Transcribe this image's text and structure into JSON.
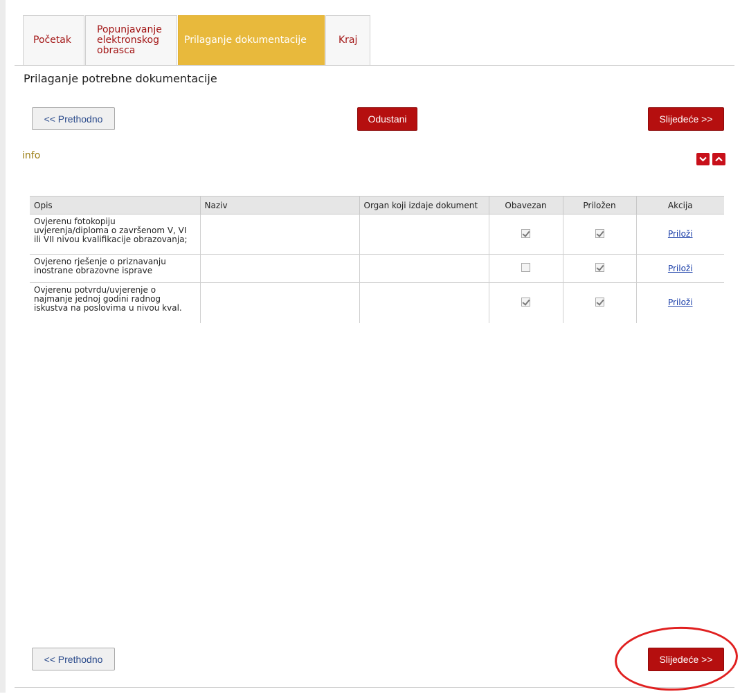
{
  "tabs": [
    {
      "label": "Početak",
      "active": false
    },
    {
      "label_lines": [
        "Popunjavanje",
        "elektronskog",
        "obrasca"
      ],
      "active": false
    },
    {
      "label": "Prilaganje dokumentacije",
      "active": true
    },
    {
      "label": "Kraj",
      "active": false
    }
  ],
  "heading": "Prilaganje potrebne dokumentacije",
  "buttons": {
    "previous": "<< Prethodno",
    "cancel": "Odustani",
    "next": "Slijedeće >>"
  },
  "info_label": "info",
  "table": {
    "headers": [
      "Opis",
      "Naziv",
      "Organ koji izdaje dokument",
      "Obavezan",
      "Priložen",
      "Akcija"
    ],
    "rows": [
      {
        "opis_lines": [
          "Ovjerenu fotokopiju",
          "uvjerenja/diploma o završenom V, VI",
          "ili VII nivou kvalifikacije obrazovanja;"
        ],
        "naziv": "",
        "organ": "",
        "obavezan": true,
        "prilozen": true,
        "akcija": "Priloži"
      },
      {
        "opis_lines": [
          "Ovjereno rješenje o priznavanju",
          "inostrane obrazovne isprave"
        ],
        "naziv": "",
        "organ": "",
        "obavezan": false,
        "prilozen": true,
        "akcija": "Priloži"
      },
      {
        "opis_lines": [
          "Ovjerenu potvrdu/uvjerenje o",
          "najmanje jednoj godini radnog",
          "iskustva na poslovima u nivou kval."
        ],
        "naziv": "",
        "organ": "",
        "obavezan": true,
        "prilozen": true,
        "akcija": "Priloži"
      }
    ]
  },
  "colors": {
    "accent_red": "#b50f0f",
    "active_tab": "#e8b93c",
    "tab_text": "#a31616",
    "info_text": "#9b7d12",
    "annotation": "#e02020"
  }
}
